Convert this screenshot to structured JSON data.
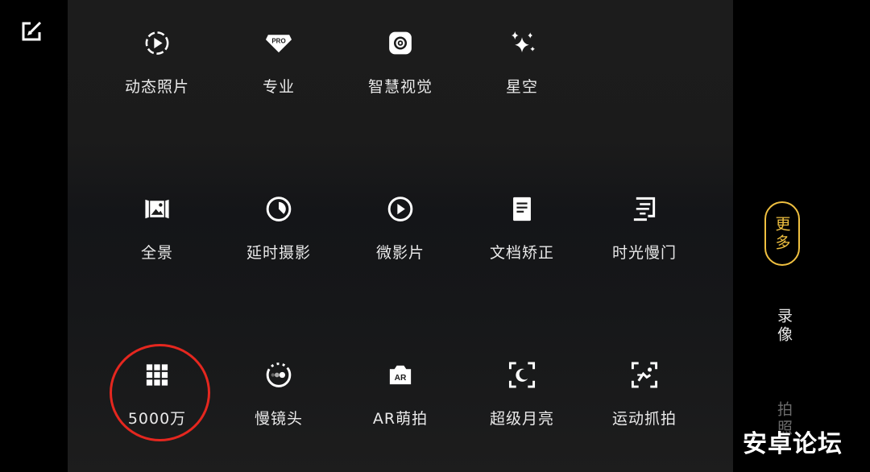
{
  "modes": [
    {
      "label": "动态照片",
      "icon": "live-photo-icon"
    },
    {
      "label": "专业",
      "icon": "pro-icon",
      "badge": "PRO"
    },
    {
      "label": "智慧视觉",
      "icon": "smart-vision-icon"
    },
    {
      "label": "星空",
      "icon": "starry-sky-icon"
    },
    {
      "label": "全景",
      "icon": "panorama-icon"
    },
    {
      "label": "延时摄影",
      "icon": "time-lapse-icon"
    },
    {
      "label": "微影片",
      "icon": "micro-movie-icon"
    },
    {
      "label": "文档矫正",
      "icon": "document-correction-icon"
    },
    {
      "label": "时光慢门",
      "icon": "slow-shutter-icon"
    },
    {
      "label": "5000万",
      "icon": "high-resolution-grid-icon"
    },
    {
      "label": "慢镜头",
      "icon": "slow-motion-icon"
    },
    {
      "label": "AR萌拍",
      "icon": "ar-camera-icon",
      "badge": "AR"
    },
    {
      "label": "超级月亮",
      "icon": "super-moon-icon"
    },
    {
      "label": "运动抓拍",
      "icon": "sports-capture-icon"
    }
  ],
  "tabs": {
    "more": "更多",
    "video": "录像",
    "photo": "拍照"
  },
  "watermark": "安卓论坛",
  "colors": {
    "accent": "#f0c040",
    "highlight_circle": "#e5271f",
    "background": "#1b1b1b"
  }
}
